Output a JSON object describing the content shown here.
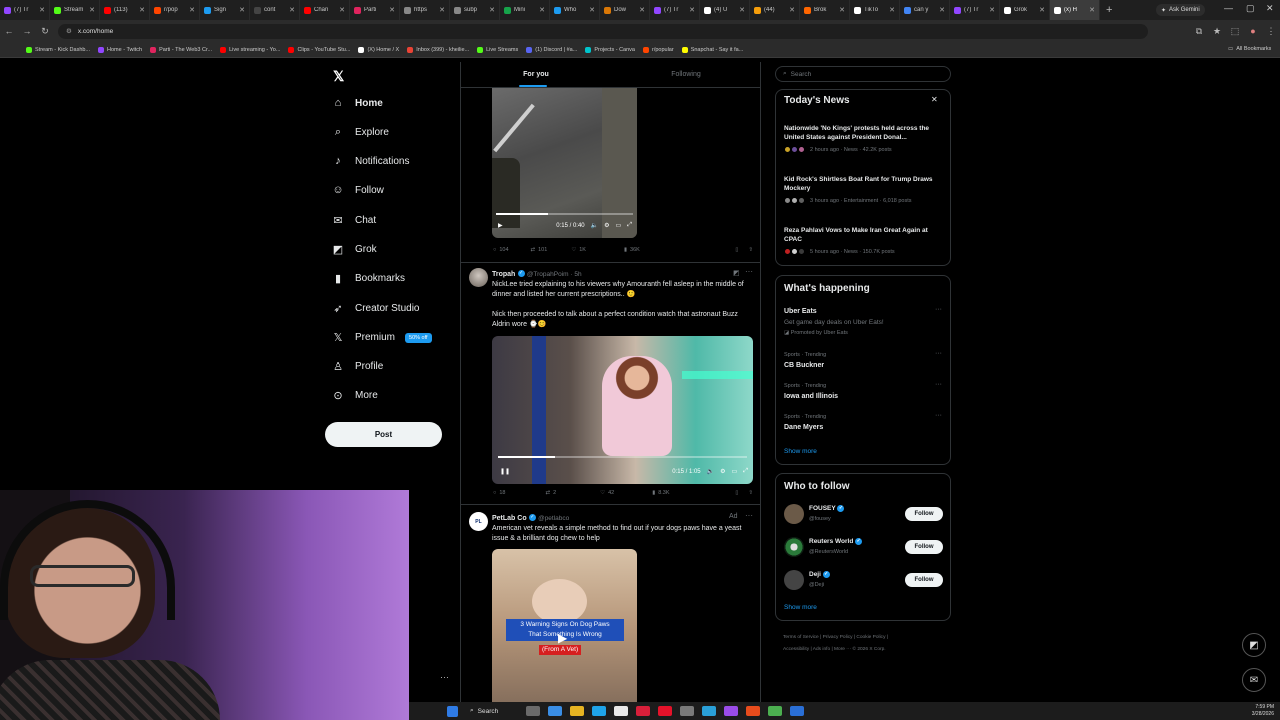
{
  "browser": {
    "tabs": [
      {
        "title": "(7) Tr",
        "color": "#9146ff"
      },
      {
        "title": "Stream",
        "color": "#53fc18"
      },
      {
        "title": "(113)",
        "color": "#ff0000"
      },
      {
        "title": "r/pop",
        "color": "#ff4500"
      },
      {
        "title": "Sign",
        "color": "#1d9bf0"
      },
      {
        "title": "cont",
        "color": "#444444"
      },
      {
        "title": "Chan",
        "color": "#ff0000"
      },
      {
        "title": "Parti",
        "color": "#e0245e"
      },
      {
        "title": "https",
        "color": "#888888"
      },
      {
        "title": "subp",
        "color": "#888888"
      },
      {
        "title": "Mini",
        "color": "#16a34a"
      },
      {
        "title": "Who",
        "color": "#1d9bf0"
      },
      {
        "title": "Dow",
        "color": "#d97706"
      },
      {
        "title": "(7) Tr",
        "color": "#9146ff"
      },
      {
        "title": "(4) U",
        "color": "#ffffff"
      },
      {
        "title": "(44)",
        "color": "#f59e0b"
      },
      {
        "title": "Brok",
        "color": "#ff6600"
      },
      {
        "title": "TikTo",
        "color": "#ffffff"
      },
      {
        "title": "can y",
        "color": "#4285f4"
      },
      {
        "title": "(7) Tr",
        "color": "#9146ff"
      },
      {
        "title": "Grok",
        "color": "#ffffff"
      },
      {
        "title": "(x) H",
        "color": "#ffffff",
        "active": true
      }
    ],
    "gemini_label": "Ask Gemini",
    "url": "x.com/home",
    "bookmarks": [
      {
        "label": "Stream - Kick Dashb...",
        "color": "#53fc18"
      },
      {
        "label": "Home - Twitch",
        "color": "#9146ff"
      },
      {
        "label": "Parti - The Web3 Cr...",
        "color": "#e0245e"
      },
      {
        "label": "Live streaming - Yo...",
        "color": "#ff0000"
      },
      {
        "label": "Clips - YouTube Stu...",
        "color": "#ff0000"
      },
      {
        "label": "(X) Home / X",
        "color": "#ffffff"
      },
      {
        "label": "Inbox (399) - kheilie...",
        "color": "#ea4335"
      },
      {
        "label": "Live Streams",
        "color": "#53fc18"
      },
      {
        "label": "(1) Discord | #a...",
        "color": "#5865f2"
      },
      {
        "label": "Projects - Canva",
        "color": "#00c4cc"
      },
      {
        "label": "r/popular",
        "color": "#ff4500"
      },
      {
        "label": "Snapchat - Say it fa...",
        "color": "#fffc00"
      }
    ],
    "all_bookmarks": "All Bookmarks"
  },
  "nav": {
    "items": [
      {
        "label": "Home",
        "icon": "home-icon",
        "glyph": "⌂"
      },
      {
        "label": "Explore",
        "icon": "search-icon",
        "glyph": "⌕"
      },
      {
        "label": "Notifications",
        "icon": "bell-icon",
        "glyph": "♪"
      },
      {
        "label": "Follow",
        "icon": "follow-icon",
        "glyph": "☺"
      },
      {
        "label": "Chat",
        "icon": "chat-icon",
        "glyph": "✉"
      },
      {
        "label": "Grok",
        "icon": "grok-icon",
        "glyph": "◩"
      },
      {
        "label": "Bookmarks",
        "icon": "bookmark-icon",
        "glyph": "▮"
      },
      {
        "label": "Creator Studio",
        "icon": "rocket-icon",
        "glyph": "➶"
      },
      {
        "label": "Premium",
        "icon": "premium-x-icon",
        "glyph": "𝕏"
      },
      {
        "label": "Profile",
        "icon": "profile-icon",
        "glyph": "♙"
      },
      {
        "label": "More",
        "icon": "more-circle-icon",
        "glyph": "⊙"
      }
    ],
    "premium_badge": "50% off",
    "post_label": "Post"
  },
  "feed": {
    "tabs": [
      {
        "label": "For you",
        "active": true
      },
      {
        "label": "Following",
        "active": false
      }
    ],
    "video1": {
      "time": "0:15 / 0:40",
      "progress": 0.38
    },
    "stats1": {
      "replies": "104",
      "reposts": "101",
      "likes": "1K",
      "views": "36K"
    },
    "post2": {
      "name": "Tropah",
      "handle": "@TropahPoim · 5h",
      "text1": "NickLee tried explaining to his viewers why Amouranth fell asleep in the middle of dinner and listed her current prescriptions.. 🙂",
      "text2": "Nick then proceeded to talk about a perfect condition watch that astronaut Buzz Aldrin wore ⌚😊",
      "video_time": "0:15 / 1:05",
      "progress": 0.23,
      "replies": "18",
      "reposts": "2",
      "likes": "42",
      "views": "8.3K"
    },
    "post3": {
      "name": "PetLab Co",
      "handle": "@petlabco",
      "ad": "Ad",
      "text": "American vet reveals a simple method to find out if your dogs paws have a yeast issue & a brilliant dog chew to help",
      "overlay_line1": "3 Warning Signs On Dog Paws",
      "overlay_line2": "That Something Is Wrong",
      "overlay_line3": "(From A Vet)"
    }
  },
  "sidebar": {
    "search_placeholder": "Search",
    "news": {
      "title": "Today's News",
      "items": [
        {
          "headline": "Nationwide 'No Kings' protests held across the United States against President Donal...",
          "meta": "2 hours ago · News · 42.2K posts"
        },
        {
          "headline": "Kid Rock's Shirtless Boat Rant for Trump Draws Mockery",
          "meta": "3 hours ago · Entertainment · 6,018 posts"
        },
        {
          "headline": "Reza Pahlavi Vows to Make Iran Great Again at CPAC",
          "meta": "5 hours ago · News · 150.7K posts"
        }
      ]
    },
    "happening": {
      "title": "What's happening",
      "promo": {
        "title": "Uber Eats",
        "desc": "Get game day deals on Uber Eats!",
        "by": "Promoted by Uber Eats"
      },
      "trends": [
        {
          "category": "Sports · Trending",
          "topic": "CB Buckner"
        },
        {
          "category": "Sports · Trending",
          "topic": "Iowa and Illinois"
        },
        {
          "category": "Sports · Trending",
          "topic": "Dane Myers"
        }
      ],
      "show_more": "Show more"
    },
    "who_to_follow": {
      "title": "Who to follow",
      "accounts": [
        {
          "name": "FOUSEY",
          "handle": "@fousey",
          "color": "#6b5a48"
        },
        {
          "name": "Reuters World",
          "handle": "@ReutersWorld",
          "color": "#1a3a22"
        },
        {
          "name": "Deji",
          "handle": "@Deji",
          "color": "#444444"
        }
      ],
      "follow_label": "Follow",
      "show_more": "Show more"
    },
    "footer": {
      "terms": "Terms of Service",
      "privacy": "Privacy Policy",
      "cookie": "Cookie Policy",
      "access": "Accessibility",
      "ads": "Ads info",
      "more": "More ···",
      "copy": "© 2026 X Corp."
    }
  },
  "taskbar": {
    "search_label": "Search",
    "time": "7:59 PM",
    "date": "3/28/2026"
  }
}
